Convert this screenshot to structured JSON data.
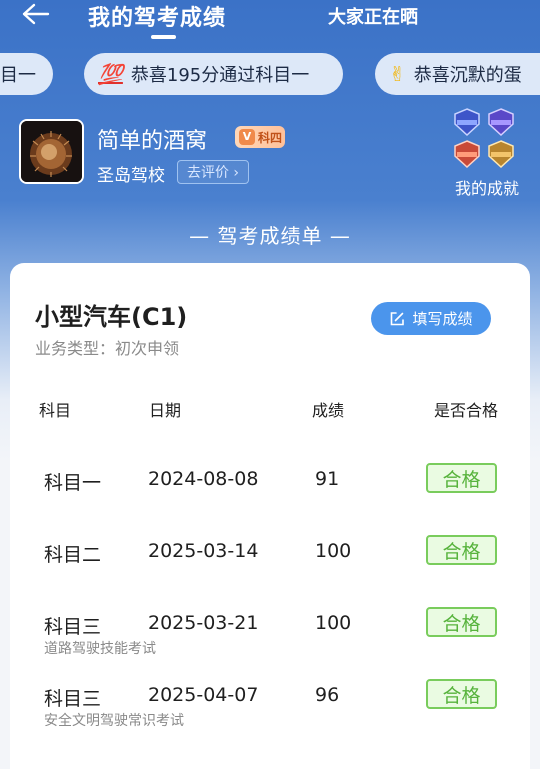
{
  "header": {
    "tab_active": "我的驾考成绩",
    "tab_other": "大家正在晒"
  },
  "ticker": [
    {
      "icon": "",
      "text": "目一"
    },
    {
      "icon": "💯",
      "text": "恭喜195分通过科目一"
    },
    {
      "icon": "✌",
      "text": "恭喜沉默的蛋"
    }
  ],
  "profile": {
    "nickname": "简单的酒窝",
    "level_v": "V",
    "level": "科四",
    "school": "圣岛驾校",
    "rate_label": "去评价 ›",
    "achievements_label": "我的成就"
  },
  "section_title": "— 驾考成绩单 —",
  "card": {
    "license": "小型汽车(C1)",
    "business_type": "业务类型：初次申领",
    "fill_button": "填写成绩",
    "columns": [
      "科目",
      "日期",
      "成绩",
      "是否合格"
    ],
    "rows": [
      {
        "subject": "科目一",
        "date": "2024-08-08",
        "score": "91",
        "status": "合格",
        "note": ""
      },
      {
        "subject": "科目二",
        "date": "2025-03-14",
        "score": "100",
        "status": "合格",
        "note": ""
      },
      {
        "subject": "科目三",
        "date": "2025-03-21",
        "score": "100",
        "status": "合格",
        "note": "道路驾驶技能考试"
      },
      {
        "subject": "科目三",
        "date": "2025-04-07",
        "score": "96",
        "status": "合格",
        "note": "安全文明驾驶常识考试"
      }
    ]
  },
  "colors": {
    "hero_blue": "#3b72c7",
    "accent_button": "#4b95ec",
    "pass_green": "#57b33c"
  }
}
